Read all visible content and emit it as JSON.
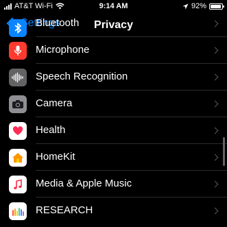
{
  "status": {
    "carrier": "AT&T Wi-Fi",
    "time": "9:14 AM",
    "battery": "92%",
    "battery_level": 0.92
  },
  "nav": {
    "back_label": "Settings",
    "title": "Privacy"
  },
  "rows": [
    {
      "label": "Bluetooth",
      "icon": "bluetooth-icon",
      "color": "#0a84ff"
    },
    {
      "label": "Microphone",
      "icon": "microphone-icon",
      "color": "#ff3b30"
    },
    {
      "label": "Speech Recognition",
      "icon": "waveform-icon",
      "color": "#8e8e93"
    },
    {
      "label": "Camera",
      "icon": "camera-icon",
      "color": "#8e8e93"
    },
    {
      "label": "Health",
      "icon": "health-heart-icon",
      "color": "#ffffff"
    },
    {
      "label": "HomeKit",
      "icon": "home-icon",
      "color": "#ffffff"
    },
    {
      "label": "Media & Apple Music",
      "icon": "music-note-icon",
      "color": "#ffffff"
    },
    {
      "label": "RESEARCH",
      "icon": "research-icon",
      "color": "#ffffff"
    }
  ]
}
